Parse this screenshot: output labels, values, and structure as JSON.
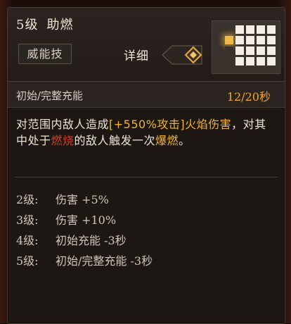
{
  "skill": {
    "level_label": "5级",
    "name": "助燃",
    "tag": "威能技",
    "detail_label": "详细"
  },
  "charge": {
    "label": "初始/完整充能",
    "cooldown": "12/20秒"
  },
  "description": {
    "part1": "对范围内敌人造成",
    "highlight1": "[+550%攻击]火焰伤害",
    "part2": "，对其中处于",
    "highlight2": "燃烧",
    "part3": "的敌人触发一次",
    "highlight3": "爆燃",
    "part4": "。"
  },
  "levels": [
    {
      "level": "2级:",
      "effect": "伤害 +5%"
    },
    {
      "level": "3级:",
      "effect": "伤害 +10%"
    },
    {
      "level": "4级:",
      "effect": "初始充能 -3秒"
    },
    {
      "level": "5级:",
      "effect": "初始/完整充能 -3秒"
    }
  ],
  "colors": {
    "accent_yellow": "#f2b233",
    "accent_red": "#d83a2a",
    "cooldown": "#f0a92c"
  },
  "range_grid": {
    "icon": "range-grid-icon",
    "rows": 4,
    "cols": 6,
    "origin_cell": [
      1,
      1
    ]
  }
}
